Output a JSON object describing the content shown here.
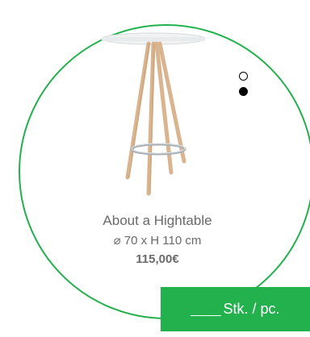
{
  "product": {
    "name": "About a Hightable",
    "dimensions": "⌀ 70 x H 110 cm",
    "price": "115,00€"
  },
  "carousel": {
    "total": 2,
    "active_index": 1
  },
  "order": {
    "quantity_label": "Stk. / pc."
  },
  "colors": {
    "frame": "#22b14c",
    "badge": "#22b14c",
    "text": "#6a6a6a"
  },
  "icons": {
    "dot_inactive": "circle-outline-icon",
    "dot_active": "circle-filled-icon"
  }
}
